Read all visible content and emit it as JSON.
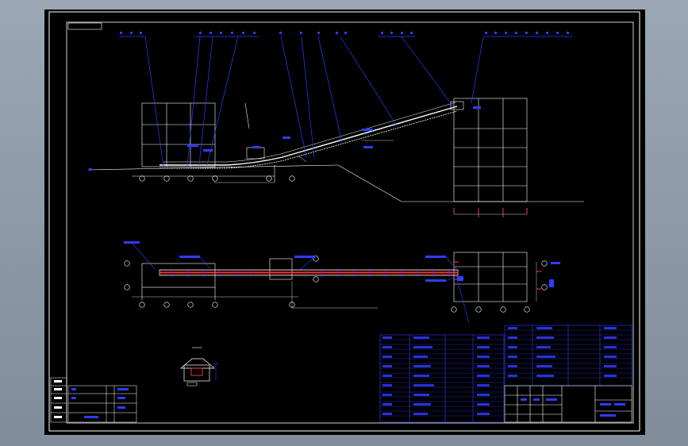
{
  "viewer": {
    "background_color": "#7f8c99",
    "canvas_color": "#000000"
  },
  "drawing": {
    "title_tag": "",
    "colors": {
      "frame": "#ffffff",
      "leader": "#2f3cff",
      "structure": "#ffffff",
      "conveyor_belt": "#ff3b3b",
      "axis_marker": "#ffffff"
    },
    "elevation_view": {},
    "plan_view": {},
    "section_view": {},
    "parts_table": {},
    "title_block": {}
  }
}
